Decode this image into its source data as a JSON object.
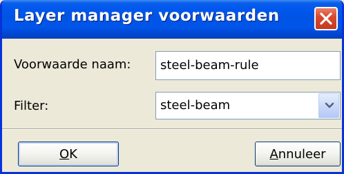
{
  "window": {
    "title": "Layer manager voorwaarden",
    "close_icon": "close-icon"
  },
  "form": {
    "name_label": "Voorwaarde naam:",
    "name_value": "steel-beam-rule",
    "filter_label": "Filter:",
    "filter_value": "steel-beam",
    "filter_arrow_icon": "chevron-down-icon"
  },
  "buttons": {
    "ok": {
      "mnemonic": "O",
      "rest": "K"
    },
    "cancel": {
      "mnemonic": "A",
      "rest": "nnuleer"
    }
  },
  "colors": {
    "titlebar": "#0054e3",
    "close": "#d84a30",
    "face": "#ece9d8",
    "field_border": "#7f9db9"
  }
}
